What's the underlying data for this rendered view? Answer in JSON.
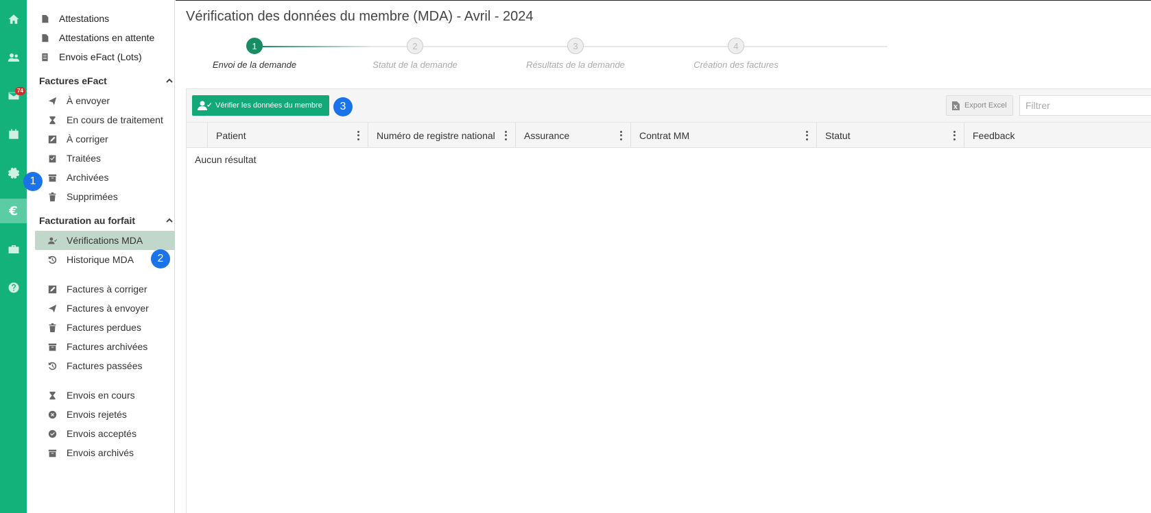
{
  "rail": {
    "badge_count": "74",
    "active_symbol": "€"
  },
  "sidebar": {
    "top_items": [
      {
        "label": "Attestations",
        "icon": "file-icon"
      },
      {
        "label": "Attestations en attente",
        "icon": "file-icon"
      },
      {
        "label": "Envois eFact (Lots)",
        "icon": "list-icon"
      }
    ],
    "section_efact": {
      "title": "Factures eFact",
      "items": [
        {
          "label": "À envoyer",
          "icon": "send-icon"
        },
        {
          "label": "En cours de traitement",
          "icon": "hourglass-icon"
        },
        {
          "label": "À corriger",
          "icon": "edit-icon"
        },
        {
          "label": "Traitées",
          "icon": "check-doc-icon"
        },
        {
          "label": "Archivées",
          "icon": "archive-icon"
        },
        {
          "label": "Supprimées",
          "icon": "trash-icon"
        }
      ]
    },
    "section_forfait": {
      "title": "Facturation au forfait",
      "items": [
        {
          "label": "Vérifications MDA",
          "icon": "user-check-icon"
        },
        {
          "label": "Historique MDA",
          "icon": "history-icon"
        }
      ],
      "invoices": [
        {
          "label": "Factures à corriger",
          "icon": "edit-icon"
        },
        {
          "label": "Factures à envoyer",
          "icon": "send-icon"
        },
        {
          "label": "Factures perdues",
          "icon": "trash-icon"
        },
        {
          "label": "Factures archivées",
          "icon": "archive-icon"
        },
        {
          "label": "Factures passées",
          "icon": "history-icon"
        }
      ],
      "sendings": [
        {
          "label": "Envois en cours",
          "icon": "hourglass-icon"
        },
        {
          "label": "Envois rejetés",
          "icon": "x-circle-icon"
        },
        {
          "label": "Envois acceptés",
          "icon": "check-circle-icon"
        },
        {
          "label": "Envois archivés",
          "icon": "archive-icon"
        }
      ]
    }
  },
  "markers": [
    "1",
    "2",
    "3"
  ],
  "main": {
    "title": "Vérification des données du membre (MDA) - Avril - 2024",
    "steps": [
      {
        "num": "1",
        "label": "Envoi de la demande"
      },
      {
        "num": "2",
        "label": "Statut de la demande"
      },
      {
        "num": "3",
        "label": "Résultats de la demande"
      },
      {
        "num": "4",
        "label": "Création des factures"
      }
    ],
    "toolbar": {
      "verify_label": "Vérifier les données du membre",
      "export_label": "Export Excel",
      "filter_placeholder": "Filtrer"
    },
    "columns": [
      "Patient",
      "Numéro de registre national",
      "Assurance",
      "Contrat MM",
      "Statut",
      "Feedback"
    ],
    "empty_text": "Aucun résultat"
  },
  "colors": {
    "brand_green": "#12b27a",
    "active_step": "#1a8c63",
    "marker_blue": "#1a73e8",
    "selected_item": "#c2d7cc"
  }
}
